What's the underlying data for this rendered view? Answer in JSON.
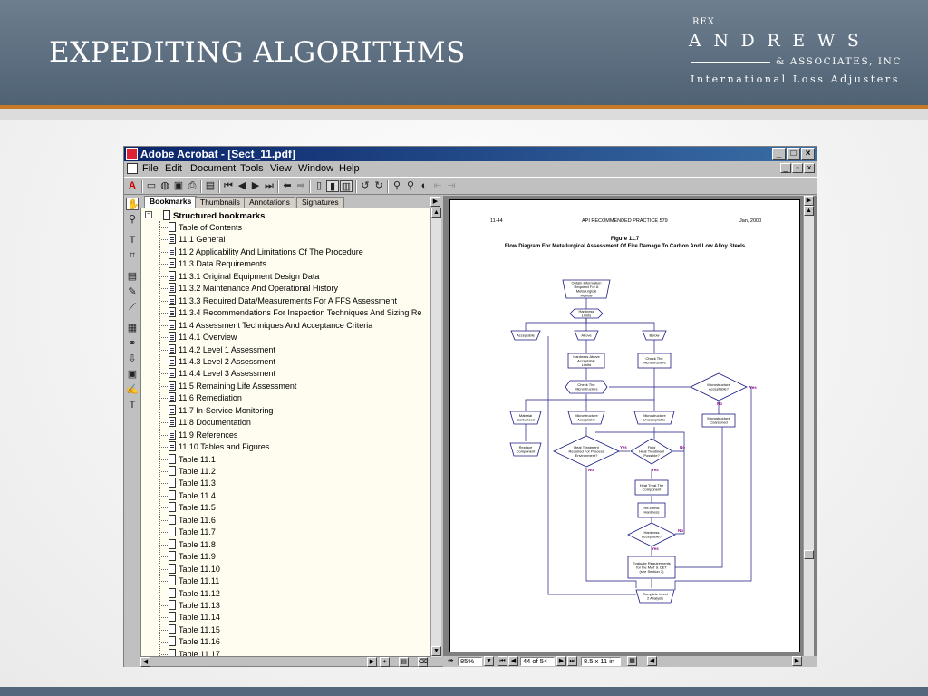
{
  "slide": {
    "title": "EXPEDITING ALGORITHMS",
    "logo": {
      "rex": "REX",
      "name": "ANDREWS",
      "associates": "& ASSOCIATES, INC",
      "tagline": "International Loss Adjusters"
    }
  },
  "window": {
    "title": "Adobe Acrobat - [Sect_11.pdf]",
    "menu": [
      "File",
      "Edit",
      "Document",
      "Tools",
      "View",
      "Window",
      "Help"
    ]
  },
  "tabs": [
    "Bookmarks",
    "Thumbnails",
    "Annotations",
    "Signatures"
  ],
  "bookmarks": {
    "root": "Structured bookmarks",
    "items": [
      "Table of Contents",
      "11.1 General",
      "11.2 Applicability And Limitations Of The Procedure",
      "11.3 Data Requirements",
      "11.3.1 Original Equipment Design Data",
      "11.3.2 Maintenance And Operational History",
      "11.3.3 Required Data/Measurements For A FFS Assessment",
      "11.3.4 Recommendations For Inspection Techniques And Sizing Re",
      "11.4 Assessment Techniques And Acceptance Criteria",
      "11.4.1 Overview",
      "11.4.2 Level 1 Assessment",
      "11.4.3 Level 2 Assessment",
      "11.4.4 Level 3 Assessment",
      "11.5 Remaining Life Assessment",
      "11.6 Remediation",
      "11.7 In-Service Monitoring",
      "11.8 Documentation",
      "11.9 References",
      "11.10 Tables and Figures",
      "Table 11.1",
      "Table 11.2",
      "Table 11.3",
      "Table 11.4",
      "Table 11.5",
      "Table 11.6",
      "Table 11.7",
      "Table 11.8",
      "Table 11.9",
      "Table 11.10",
      "Table 11.11",
      "Table 11.12",
      "Table 11.13",
      "Table 11.14",
      "Table 11.15",
      "Table 11.16",
      "Table 11.17"
    ]
  },
  "page": {
    "header_left": "11-44",
    "header_center": "API RECOMMENDED PRACTICE 579",
    "header_right": "Jan, 2000",
    "figure_label": "Figure 11.7",
    "figure_title": "Flow Diagram For Metallurgical Assessment Of Fire Damage To Carbon And Low Alloy Steels"
  },
  "flowchart": {
    "obtain": [
      "Obtain Information",
      "Required For A",
      "Metallurgical",
      "Review"
    ],
    "hardness_limits": [
      "Hardness",
      "Limits"
    ],
    "acceptable": "Acceptable",
    "above": "Above",
    "below": "Below",
    "hardness_above": [
      "Hardness Above",
      "Acceptable",
      "Limits"
    ],
    "check_micro_1": [
      "Check The",
      "Microstructure"
    ],
    "check_micro_2": [
      "Check The",
      "Microstructure"
    ],
    "micro_acceptable_q": [
      "Microstructure",
      "Acceptable?"
    ],
    "material_carburized": [
      "Material",
      "Carburized"
    ],
    "micro_acceptable": [
      "Microstructure",
      "Acceptable"
    ],
    "micro_unacceptable": [
      "Microstructure",
      "Unacceptable"
    ],
    "micro_coarsened": [
      "Microstructure",
      "Coarsened"
    ],
    "replace": [
      "Replace",
      "Component"
    ],
    "heat_treat_required": [
      "Heat Treatment",
      "Required For Process",
      "Environment?"
    ],
    "pwht_possible": [
      "Field",
      "Heat Treatment",
      "Possible?"
    ],
    "heat_treat_component": [
      "Heat Treat The",
      "Component"
    ],
    "recheck": [
      "Re-check",
      "Hardness"
    ],
    "hardness_acceptable": [
      "Hardness",
      "Acceptable?"
    ],
    "evaluate": [
      "Evaluate Requirements",
      "for the MAT & CET",
      "(see Section 3)"
    ],
    "complete": [
      "Complete Level",
      "2 Analysis"
    ],
    "yes": "Yes",
    "no": "No"
  },
  "status": {
    "zoom": "85%",
    "page": "44 of 54",
    "page_size": "8.5 x 11 in"
  }
}
